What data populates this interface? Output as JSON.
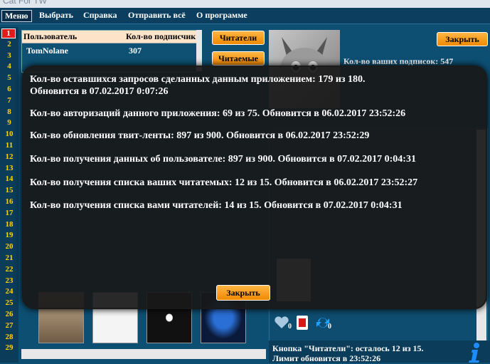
{
  "window": {
    "title": "Cat For TW"
  },
  "menu": [
    {
      "label": "Меню"
    },
    {
      "label": "Выбрать"
    },
    {
      "label": "Справка"
    },
    {
      "label": "Отправить всё"
    },
    {
      "label": "О программе"
    }
  ],
  "row_numbers": [
    "1",
    "2",
    "3",
    "4",
    "5",
    "6",
    "7",
    "8",
    "9",
    "10",
    "11",
    "12",
    "13",
    "14",
    "15",
    "16",
    "17",
    "18",
    "19",
    "20",
    "21",
    "22",
    "23",
    "24",
    "25",
    "26",
    "27",
    "28",
    "29"
  ],
  "table": {
    "headers": [
      "Пользователь",
      "Кол-во подписчик"
    ],
    "rows": [
      {
        "user": "TomNolane",
        "count": "307"
      }
    ]
  },
  "buttons": {
    "readers": "Читатели",
    "readable": "Читаемые",
    "close_top": "Закрыть"
  },
  "profile": {
    "subs_label": "Кол-во ваших подписок: 547"
  },
  "bottom": {
    "line1": "Кнопка \"Читатели\": осталось 12 из 15.",
    "line2": "Лимит обновится в 23:52:26"
  },
  "tweet_icons": {
    "likes": "0",
    "retweets": "0"
  },
  "modal": {
    "lines": [
      "Кол-во оставшихся запросов сделанных данным приложением: 179 из 180.",
      "Обновится в 07.02.2017 0:07:26",
      "Кол-во авторизаций данного приложения: 69 из 75. Обновится в 06.02.2017 23:52:26",
      "Кол-во обновления твит-ленты: 897 из 900. Обновится в 06.02.2017 23:52:29",
      "Кол-во получения данных об пользователе: 897 из 900. Обновится в 07.02.2017 0:04:31",
      "Кол-во получения списка ваших читатемых: 12 из 15. Обновится в 06.02.2017 23:52:27",
      "Кол-во получения списка вами читателей: 14 из 15. Обновится в 07.02.2017 0:04:31"
    ],
    "close_label": "Закрыть"
  },
  "colors": {
    "accent": "#f08a00",
    "background": "#0d4f73",
    "row_number": "#ffd400",
    "modal_bg": "#191919"
  }
}
